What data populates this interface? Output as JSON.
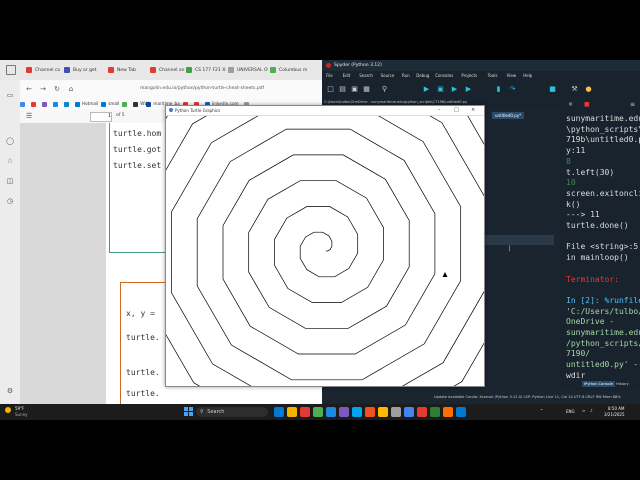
{
  "browser": {
    "tabs": [
      {
        "label": "Channel co",
        "color": "#e53935"
      },
      {
        "label": "Buy or get",
        "color": "#3f51b5"
      },
      {
        "label": "New Tab",
        "color": "#e53935"
      },
      {
        "label": "Channel an",
        "color": "#e53935"
      },
      {
        "label": "CS 177 F21 X-Arr",
        "color": "#43a047"
      },
      {
        "label": "UNIVERSAL OUT",
        "color": "#9e9e9e"
      },
      {
        "label": "Columbus m",
        "color": "#4caf50"
      }
    ],
    "url": "mangolin.edu.io/python/python-turtle-cheat-sheets.pdf",
    "bookmarks": [
      {
        "label": "",
        "color": "#4285f4"
      },
      {
        "label": "",
        "color": "#e53935"
      },
      {
        "label": "",
        "color": "#7e57c2"
      },
      {
        "label": "",
        "color": "#1e88e5"
      },
      {
        "label": "",
        "color": "#0288d1"
      },
      {
        "label": "Hotmail",
        "color": "#0078d4"
      },
      {
        "label": "small",
        "color": "#0078d4"
      },
      {
        "label": "",
        "color": "#4caf50"
      },
      {
        "label": "WW",
        "color": "#333333"
      },
      {
        "label": "maritime_ba",
        "color": "#0d47a1"
      },
      {
        "label": "",
        "color": "#e53935"
      },
      {
        "label": "",
        "color": "#e53935"
      },
      {
        "label": "linkedin.com",
        "color": "#0a66c2"
      },
      {
        "label": "",
        "color": "#9e9e9e"
      }
    ],
    "pdf": {
      "page_input": "1",
      "page_total": "of 5"
    },
    "code_lines": [
      "turtle.hom",
      "turtle.got",
      "turtle.set"
    ],
    "code_lines_lower": [
      "x, y =",
      "turtle.",
      "turtle.",
      "turtle."
    ]
  },
  "spyder": {
    "title": "Spyder (Python 3.12)",
    "menu": [
      "File",
      "Edit",
      "Search",
      "Source",
      "Run",
      "Debug",
      "Consoles",
      "Projects",
      "Tools",
      "View",
      "Help"
    ],
    "path": "C:\\Users\\tulbo\\OneDrive - sunymaritime.edu\\python_scripts\\C7196\\untitled0.py",
    "tab": "untitled0.py*",
    "console_lines": [
      {
        "text": "sunymaritime.edu",
        "color": "#dddddd"
      },
      {
        "text": "\\python_scripts\\C",
        "color": "#dddddd"
      },
      {
        "text": "719b\\untitled0.py",
        "color": "#dddddd"
      },
      {
        "text": "y:11",
        "color": "#dddddd"
      },
      {
        "text": "8",
        "color": "#3f8a4a"
      },
      {
        "text": "t.left(30)",
        "color": "#dddddd"
      },
      {
        "text": "10",
        "color": "#3f8a4a"
      },
      {
        "text": "screen.exitonclic",
        "color": "#dddddd"
      },
      {
        "text": "k()",
        "color": "#dddddd"
      },
      {
        "text": "---> 11",
        "color": "#dddddd"
      },
      {
        "text": "turtle.done()",
        "color": "#dddddd"
      },
      {
        "text": "",
        "color": "#dddddd"
      },
      {
        "text": "File <string>:5,",
        "color": "#dddddd"
      },
      {
        "text": "in mainloop()",
        "color": "#dddddd"
      },
      {
        "text": "",
        "color": "#dddddd"
      },
      {
        "text": "Terminator:",
        "color": "#e53935"
      },
      {
        "text": "",
        "color": "#dddddd"
      },
      {
        "text": "In [2]: %runfile",
        "color": "#4fc3f7"
      },
      {
        "text": "'C:/Users/tulbo/",
        "color": "#a5d6a7"
      },
      {
        "text": "OneDrive -",
        "color": "#a5d6a7"
      },
      {
        "text": "sunymaritime.edu",
        "color": "#a5d6a7"
      },
      {
        "text": "/python_scripts/C",
        "color": "#a5d6a7"
      },
      {
        "text": "7190/",
        "color": "#a5d6a7"
      },
      {
        "text": "untitled0.py' --",
        "color": "#a5d6a7"
      },
      {
        "text": "wdir",
        "color": "#dddddd"
      }
    ],
    "console_tabs": [
      "IPython Console",
      "History"
    ],
    "status": "Update available   Conda: Xconsol (Python 3.12.0)   LSP: Python   Line 11, Col 14   UTF-8   CRLF   RW   Mem 88%"
  },
  "turtle": {
    "title": "Python Turtle Graphics"
  },
  "taskbar": {
    "weather_temp": "59°F",
    "weather_desc": "Sunny",
    "search": "Search",
    "tray_lang": "ENG",
    "time": "8:50 AM",
    "date": "3/21/2025",
    "icon_colors": [
      "#0078d4",
      "#f4b400",
      "#e53935",
      "#4caf50",
      "#1e88e5",
      "#7e57c2",
      "#00a4ef",
      "#f25022",
      "#ffb900",
      "#9e9e9e",
      "#4285f4",
      "#e53935",
      "#2e7d32",
      "#ff6f00",
      "#0078d4"
    ]
  }
}
